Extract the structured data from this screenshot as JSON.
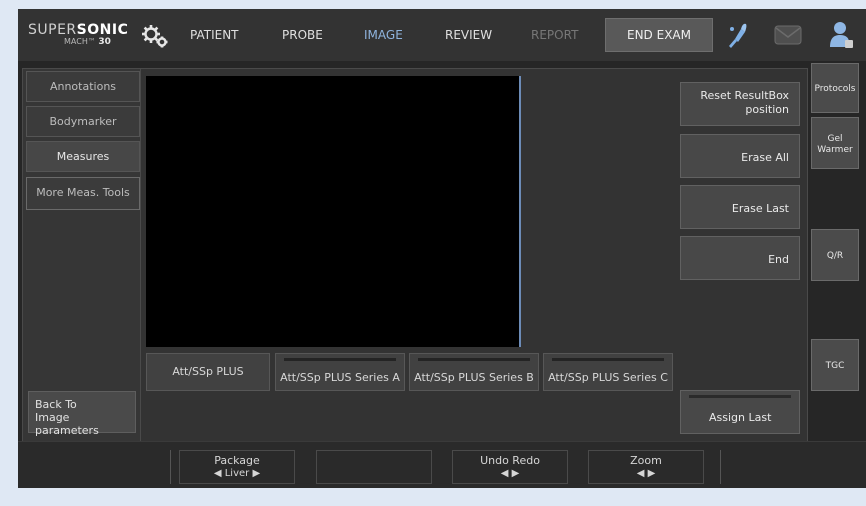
{
  "brand": {
    "name_light": "SUPER",
    "name_bold": "SONIC",
    "model_prefix": "MACH",
    "model_tm": "™",
    "model_number": "30"
  },
  "nav": {
    "patient": "PATIENT",
    "probe": "PROBE",
    "image": "IMAGE",
    "review": "REVIEW",
    "report": "REPORT",
    "end_exam": "END EXAM"
  },
  "left_menu": {
    "annotations": "Annotations",
    "bodymarker": "Bodymarker",
    "measures": "Measures",
    "more_meas_tools": "More Meas. Tools",
    "back_line1": "Back To",
    "back_line2": "Image parameters"
  },
  "sub_tabs": [
    "Att/SSp PLUS",
    "Att/SSp PLUS Series A",
    "Att/SSp PLUS Series B",
    "Att/SSp PLUS Series C"
  ],
  "right_actions": {
    "reset_line1": "Reset ResultBox",
    "reset_line2": "position",
    "erase_all": "Erase All",
    "erase_last": "Erase Last",
    "end": "End",
    "assign_last": "Assign Last"
  },
  "side_tabs": {
    "protocols": "Protocols",
    "gel_line1": "Gel",
    "gel_line2": "Warmer",
    "qr": "Q/R",
    "tgc": "TGC"
  },
  "bottom_knobs": {
    "package_label": "Package",
    "package_value": "◀ Liver ▶",
    "undo_redo_label": "Undo Redo",
    "undo_redo_value": "◀ ▶",
    "zoom_label": "Zoom",
    "zoom_value": "◀ ▶"
  },
  "icons": {
    "gears": "gears-icon",
    "probe": "probe-icon",
    "mail": "mail-icon",
    "user": "user-icon"
  },
  "colors": {
    "active_tab": "#8fb4de",
    "cursor_line": "#6d8cb8",
    "probe_icon": "#7fb0e6",
    "user_icon": "#8fb7e4"
  }
}
